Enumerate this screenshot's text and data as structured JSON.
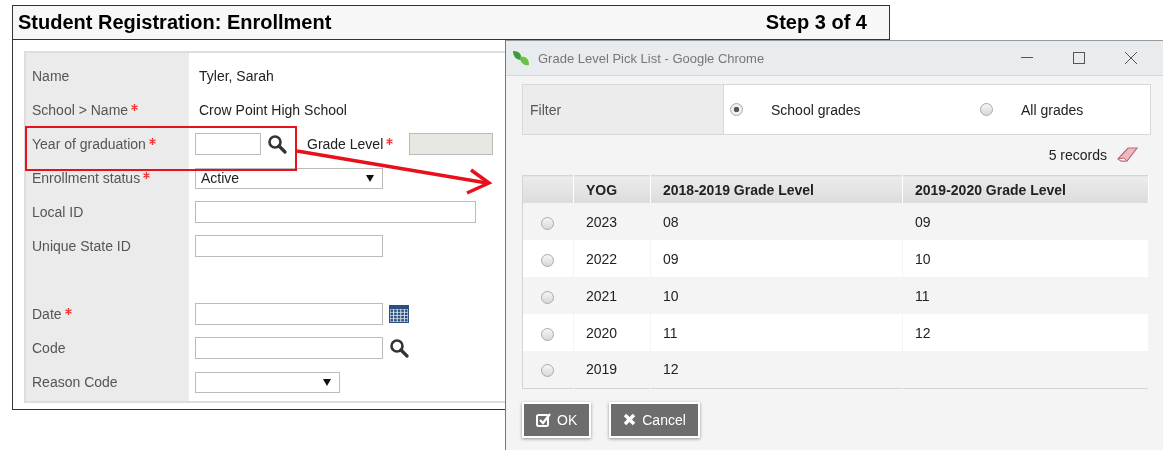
{
  "main_window": {
    "title": "Student Registration: Enrollment",
    "step": "Step 3 of 4",
    "fields": [
      {
        "kind": "text",
        "label": "Name",
        "required": false,
        "value": "Tyler, Sarah"
      },
      {
        "kind": "text",
        "label": "School > Name",
        "required": true,
        "value": "Crow Point High School"
      },
      {
        "kind": "lookup",
        "label": "Year of graduation",
        "required": true,
        "highlighted": true,
        "extra": {
          "label": "Grade Level",
          "required": true
        }
      },
      {
        "kind": "select",
        "label": "Enrollment status",
        "required": true,
        "value": "Active"
      },
      {
        "kind": "long-input",
        "label": "Local ID",
        "required": false
      },
      {
        "kind": "input",
        "label": "Unique State ID",
        "required": false
      },
      {
        "kind": "blank"
      },
      {
        "kind": "date",
        "label": "Date",
        "required": true
      },
      {
        "kind": "search",
        "label": "Code",
        "required": false
      },
      {
        "kind": "short-select",
        "label": "Reason Code",
        "required": false
      }
    ]
  },
  "pick_list": {
    "title": "Grade Level Pick List - Google Chrome",
    "filter": {
      "label": "Filter",
      "options": [
        {
          "label": "School grades",
          "selected": true
        },
        {
          "label": "All grades",
          "selected": false
        }
      ]
    },
    "records": "5 records",
    "table": {
      "columns": [
        "YOG",
        "2018-2019 Grade Level",
        "2019-2020 Grade Level"
      ],
      "rows": [
        {
          "selected": false,
          "cells": [
            "2023",
            "08",
            "09"
          ]
        },
        {
          "selected": false,
          "cells": [
            "2022",
            "09",
            "10"
          ]
        },
        {
          "selected": false,
          "cells": [
            "2021",
            "10",
            "11"
          ]
        },
        {
          "selected": false,
          "cells": [
            "2020",
            "11",
            "12"
          ]
        },
        {
          "selected": false,
          "cells": [
            "2019",
            "12"
          ]
        }
      ]
    },
    "buttons": [
      {
        "kind": "ok",
        "label": "OK"
      },
      {
        "kind": "cancel",
        "label": "Cancel"
      }
    ]
  }
}
